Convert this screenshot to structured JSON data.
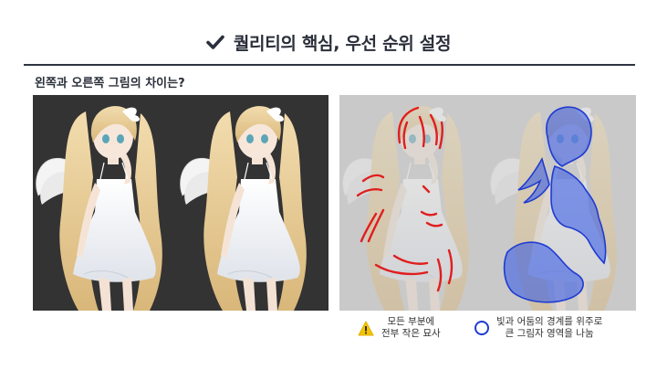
{
  "header": {
    "title": "퀄리티의 핵심, 우선 순위 설정",
    "check_icon": "check-icon"
  },
  "question": "왼쪽과 오른쪽 그림의 차이는?",
  "colors": {
    "dark_panel": "#333333",
    "light_panel": "#c9c9c9",
    "red_stroke": "#e01e1e",
    "blue_fill": "#2e54e8",
    "warning": "#f5c400"
  },
  "legend": {
    "warning": {
      "icon": "warning-icon",
      "line1": "모든 부분에",
      "line2": "전부 작은 묘사"
    },
    "circle": {
      "icon": "circle-icon",
      "line1": "빛과 어둠의 경계를 위주로",
      "line2": "큰 그림자 영역을 나눔"
    }
  }
}
